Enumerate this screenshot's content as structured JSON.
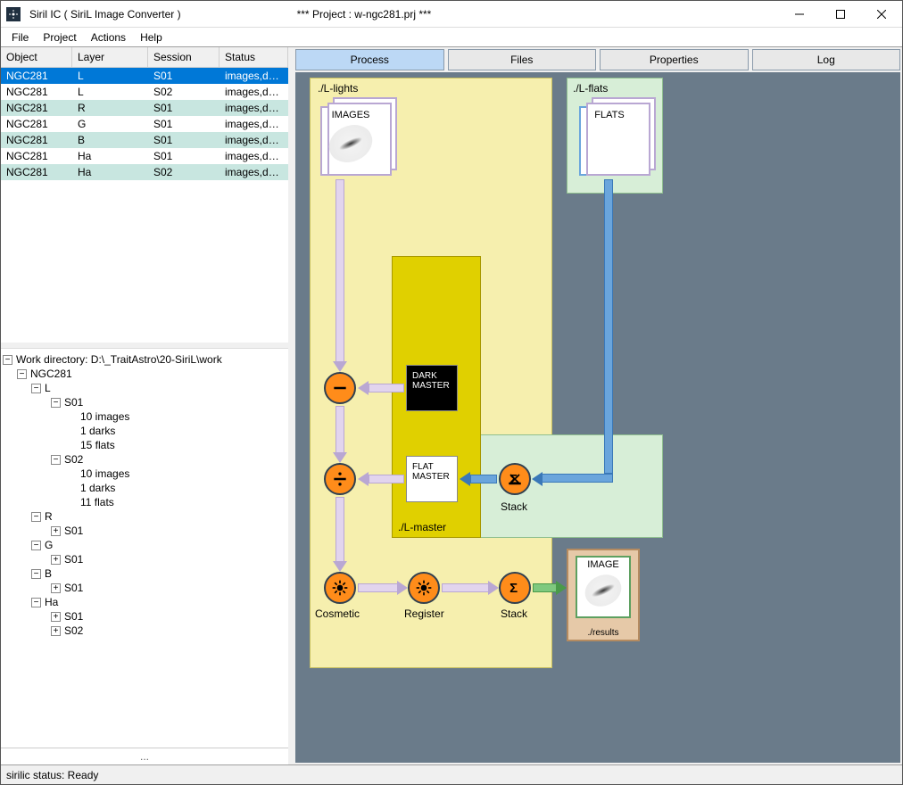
{
  "titlebar": {
    "app": "Siril IC  ( SiriL Image Converter )",
    "project": "*** Project : w-ngc281.prj ***"
  },
  "menu": {
    "file": "File",
    "project": "Project",
    "actions": "Actions",
    "help": "Help"
  },
  "tabs": {
    "process": "Process",
    "files": "Files",
    "properties": "Properties",
    "log": "Log"
  },
  "table": {
    "headers": {
      "object": "Object",
      "layer": "Layer",
      "session": "Session",
      "status": "Status"
    },
    "rows": [
      {
        "object": "NGC281",
        "layer": "L",
        "session": "S01",
        "status": "images,dar...",
        "sel": true
      },
      {
        "object": "NGC281",
        "layer": "L",
        "session": "S02",
        "status": "images,dar..."
      },
      {
        "object": "NGC281",
        "layer": "R",
        "session": "S01",
        "status": "images,dar...",
        "alt": true
      },
      {
        "object": "NGC281",
        "layer": "G",
        "session": "S01",
        "status": "images,dar..."
      },
      {
        "object": "NGC281",
        "layer": "B",
        "session": "S01",
        "status": "images,dar...",
        "alt": true
      },
      {
        "object": "NGC281",
        "layer": "Ha",
        "session": "S01",
        "status": "images,dar..."
      },
      {
        "object": "NGC281",
        "layer": "Ha",
        "session": "S02",
        "status": "images,dar...",
        "alt": true
      }
    ]
  },
  "tree": {
    "root": "Work directory: D:\\_TraitAstro\\20-SiriL\\work",
    "obj": "NGC281",
    "layers": {
      "L": {
        "S01": {
          "images": "10 images",
          "darks": "1 darks",
          "flats": "15 flats"
        },
        "S02": {
          "images": "10 images",
          "darks": "1 darks",
          "flats": "11 flats"
        }
      },
      "R": {
        "S01": {}
      },
      "G": {
        "S01": {}
      },
      "B": {
        "S01": {}
      },
      "Ha": {
        "S01": {},
        "S02": {}
      }
    }
  },
  "diagram": {
    "lights_title": "./L-lights",
    "flats_title": "./L-flats",
    "master_title": "./L-master",
    "results_title": "./results",
    "images": "IMAGES",
    "flats": "FLATS",
    "image": "IMAGE",
    "darkmaster": "DARK MASTER",
    "flatmaster": "FLAT MASTER",
    "stack": "Stack",
    "cosmetic": "Cosmetic",
    "register": "Register"
  },
  "status": {
    "text": "sirilic status: Ready"
  },
  "misc": {
    "dots": "..."
  }
}
